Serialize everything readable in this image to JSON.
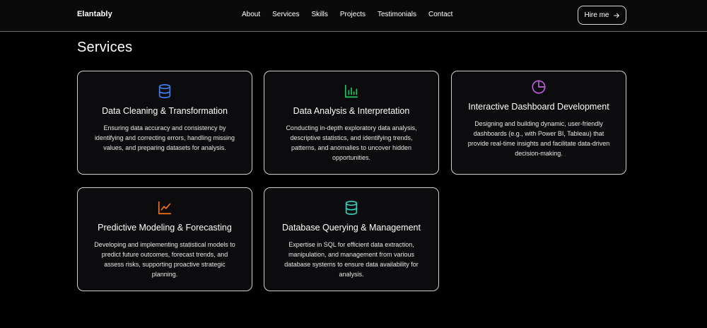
{
  "brand": "Elantably",
  "nav": {
    "links": [
      "About",
      "Services",
      "Skills",
      "Projects",
      "Testimonials",
      "Contact"
    ],
    "cta_label": "Hire me"
  },
  "section_title": "Services",
  "services": [
    {
      "title": "Data Cleaning & Transformation",
      "description": "Ensuring data accuracy and consistency by identifying and correcting errors, handling missing values, and preparing datasets for analysis.",
      "icon": "database-icon",
      "color": "#3b82f6"
    },
    {
      "title": "Data Analysis & Interpretation",
      "description": "Conducting in-depth exploratory data analysis, descriptive statistics, and identifying trends, patterns, and anomalies to uncover hidden opportunities.",
      "icon": "bar-chart-icon",
      "color": "#22c55e"
    },
    {
      "title": "Interactive Dashboard Development",
      "description": "Designing and building dynamic, user-friendly dashboards (e.g., with Power BI, Tableau) that provide real-time insights and facilitate data-driven decision-making.",
      "icon": "pie-chart-icon",
      "color": "#c05de0"
    },
    {
      "title": "Predictive Modeling & Forecasting",
      "description": "Developing and implementing statistical models to predict future outcomes, forecast trends, and assess risks, supporting proactive strategic planning.",
      "icon": "line-chart-icon",
      "color": "#f97316"
    },
    {
      "title": "Database Querying & Management",
      "description": "Expertise in SQL for efficient data extraction, manipulation, and management from various database systems to ensure data availability for analysis.",
      "icon": "database-icon",
      "color": "#2dd4bf"
    }
  ]
}
